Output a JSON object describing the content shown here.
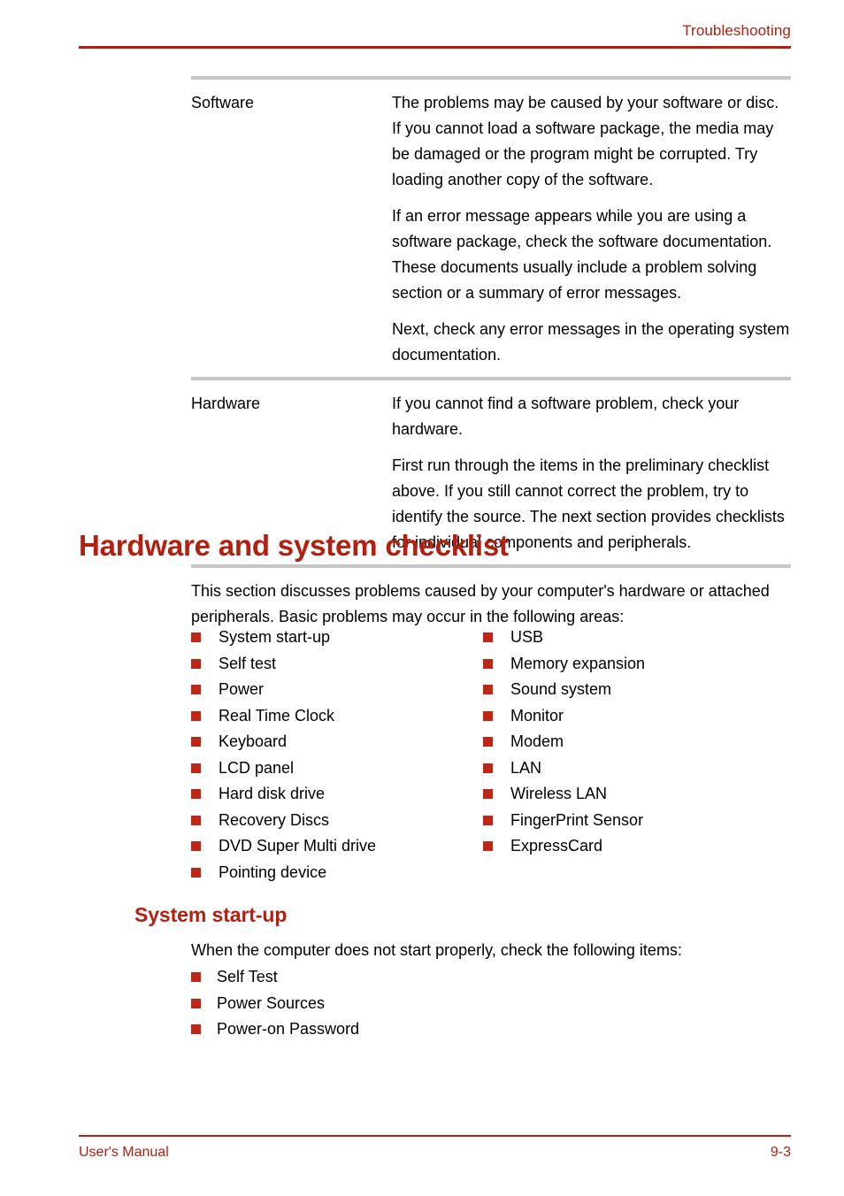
{
  "colors": {
    "accent_red": "#B3200F",
    "bullet_red": "#BE2718",
    "rule_gray": "#C6C6C6",
    "text_black": "#000000"
  },
  "header": {
    "title": "Troubleshooting"
  },
  "definition_table": {
    "rows": [
      {
        "term": "Software",
        "paragraphs": [
          "The problems may be caused by your software or disc. If you cannot load a software package, the media may be damaged or the program might be corrupted. Try loading another copy of the software.",
          "If an error message appears while you are using a software package, check the software documentation. These documents usually include a problem solving section or a summary of error messages.",
          "Next, check any error messages in the operating system documentation."
        ]
      },
      {
        "term": "Hardware",
        "paragraphs": [
          "If you cannot find a software problem, check your hardware.",
          "First run through the items in the preliminary checklist above. If you still cannot correct the problem, try to identify the source. The next section provides checklists for individual components and peripherals."
        ]
      }
    ]
  },
  "section": {
    "heading": "Hardware and system checklist",
    "intro": "This section discusses problems caused by your computer's hardware or attached peripherals. Basic problems may occur in the following areas:",
    "checklist_left": [
      "System start-up",
      "Self test",
      "Power",
      "Real Time Clock",
      "Keyboard",
      "LCD panel",
      "Hard disk drive",
      "Recovery Discs",
      "DVD Super Multi drive",
      "Pointing device"
    ],
    "checklist_right": [
      "USB",
      "Memory expansion",
      "Sound system",
      "Monitor",
      "Modem",
      "LAN",
      "Wireless LAN",
      "FingerPrint Sensor",
      "ExpressCard"
    ]
  },
  "subsection": {
    "heading": "System start-up",
    "intro": "When the computer does not start properly, check the following items:",
    "items": [
      "Self Test",
      "Power Sources",
      "Power-on Password"
    ]
  },
  "footer": {
    "left": "User's Manual",
    "right": "9-3"
  }
}
